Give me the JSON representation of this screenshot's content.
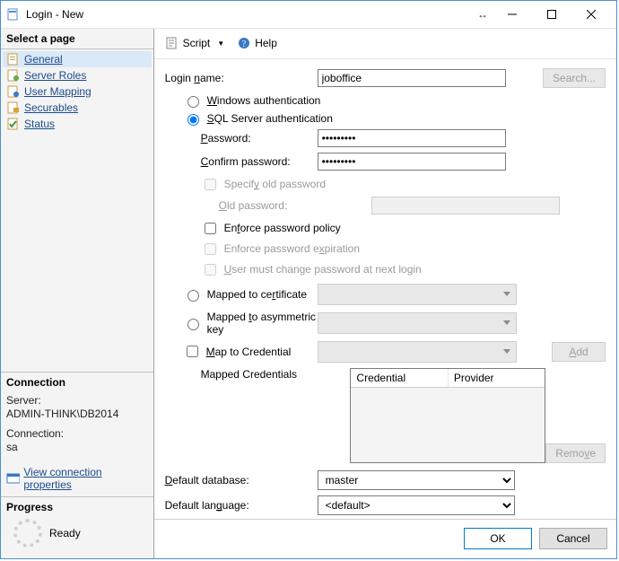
{
  "window": {
    "title": "Login - New"
  },
  "toolbar": {
    "script": "Script",
    "help": "Help"
  },
  "sidebar": {
    "select_header": "Select a page",
    "pages": [
      "General",
      "Server Roles",
      "User Mapping",
      "Securables",
      "Status"
    ],
    "connection_header": "Connection",
    "server_label": "Server:",
    "server_value": "ADMIN-THINK\\DB2014",
    "connection_label": "Connection:",
    "connection_value": "sa",
    "view_props": "View connection properties",
    "progress_header": "Progress",
    "progress_value": "Ready"
  },
  "form": {
    "login_name_label": "Login name:",
    "login_name_value": "joboffice",
    "search_btn": "Search...",
    "windows_auth": "Windows authentication",
    "sql_auth": "SQL Server authentication",
    "password_label": "Password:",
    "password_value": "•••••••••",
    "confirm_label": "Confirm password:",
    "confirm_value": "•••••••••",
    "specify_old": "Specify old password",
    "old_password_label": "Old password:",
    "enforce_policy": "Enforce password policy",
    "enforce_expiration": "Enforce password expiration",
    "must_change": "User must change password at next login",
    "mapped_cert": "Mapped to certificate",
    "mapped_asym": "Mapped to asymmetric key",
    "map_credential": "Map to Credential",
    "add_btn": "Add",
    "mapped_credentials_label": "Mapped Credentials",
    "col_credential": "Credential",
    "col_provider": "Provider",
    "remove_btn": "Remove",
    "default_db_label": "Default database:",
    "default_db_value": "master",
    "default_lang_label": "Default language:",
    "default_lang_value": "<default>"
  },
  "footer": {
    "ok": "OK",
    "cancel": "Cancel"
  }
}
